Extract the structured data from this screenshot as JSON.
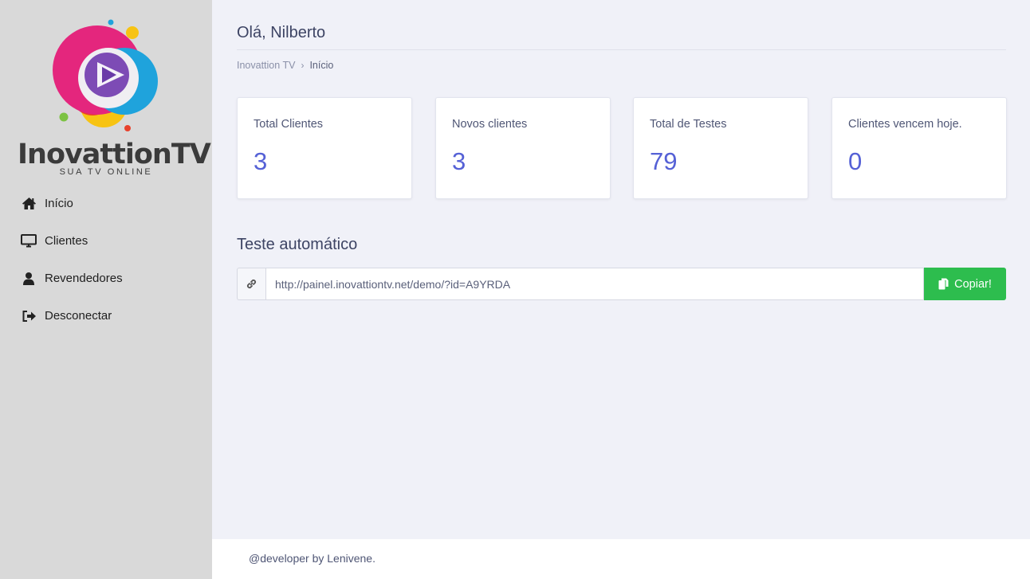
{
  "sidebar": {
    "brand": {
      "name": "InovattionTV",
      "tagline": "SUA TV ONLINE"
    },
    "items": [
      {
        "label": "Início",
        "icon": "home-icon"
      },
      {
        "label": "Clientes",
        "icon": "monitor-icon"
      },
      {
        "label": "Revendedores",
        "icon": "user-icon"
      },
      {
        "label": "Desconectar",
        "icon": "sign-out-icon"
      }
    ]
  },
  "header": {
    "greeting": "Olá, Nilberto",
    "breadcrumb": [
      "Inovattion TV",
      "Início"
    ]
  },
  "stats": [
    {
      "title": "Total Clientes",
      "value": "3"
    },
    {
      "title": "Novos clientes",
      "value": "3"
    },
    {
      "title": "Total de Testes",
      "value": "79"
    },
    {
      "title": "Clientes vencem hoje.",
      "value": "0"
    }
  ],
  "auto_test": {
    "title": "Teste automático",
    "url": "http://painel.inovattiontv.net/demo/?id=A9YRDA",
    "copy_label": "Copiar!"
  },
  "footer": {
    "text": "@developer by Lenivene."
  },
  "colors": {
    "accent": "#5561d6",
    "success": "#2dbd4e",
    "sidebar_bg": "#d9d9d9",
    "page_bg": "#f0f1f8"
  }
}
